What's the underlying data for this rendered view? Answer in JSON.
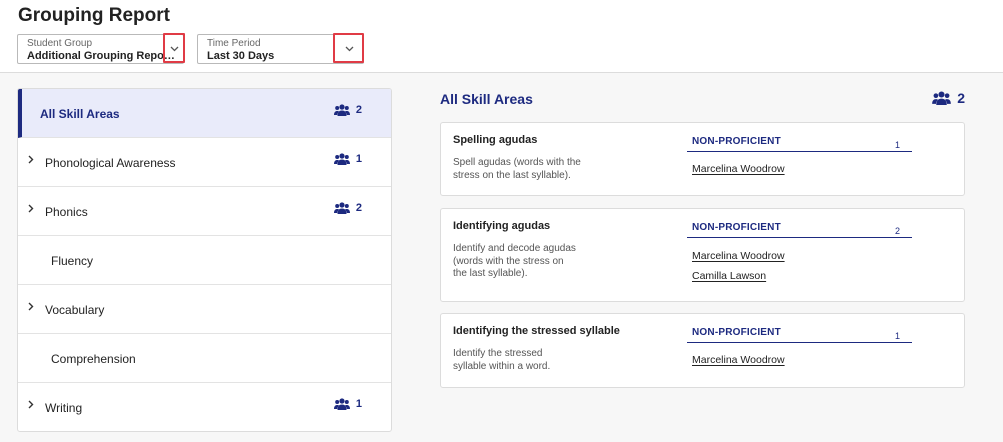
{
  "header": {
    "title": "Grouping Report",
    "filters": [
      {
        "label": "Student Group",
        "value": "Additional Grouping Report ..."
      },
      {
        "label": "Time Period",
        "value": "Last 30 Days"
      }
    ]
  },
  "sidebar": {
    "items": [
      {
        "label": "All Skill Areas",
        "count": "2"
      },
      {
        "label": "Phonological Awareness",
        "count": "1"
      },
      {
        "label": "Phonics",
        "count": "2"
      },
      {
        "label": "Fluency",
        "count": ""
      },
      {
        "label": "Vocabulary",
        "count": ""
      },
      {
        "label": "Comprehension",
        "count": ""
      },
      {
        "label": "Writing",
        "count": "1"
      }
    ]
  },
  "main": {
    "title": "All Skill Areas",
    "count": "2",
    "cards": [
      {
        "title": "Spelling agudas",
        "desc_lines": [
          "Spell agudas (words with the",
          "stress on the last syllable)."
        ],
        "proficiency": "NON-PROFICIENT",
        "count": "1",
        "students": [
          "Marcelina Woodrow"
        ]
      },
      {
        "title": "Identifying agudas",
        "desc_lines": [
          "Identify and decode agudas",
          "(words with the stress on",
          "the last syllable)."
        ],
        "proficiency": "NON-PROFICIENT",
        "count": "2",
        "students": [
          "Marcelina Woodrow",
          "Camilla Lawson"
        ]
      },
      {
        "title": "Identifying the stressed syllable",
        "desc_lines": [
          "Identify the stressed",
          "syllable within a word."
        ],
        "proficiency": "NON-PROFICIENT",
        "count": "1",
        "students": [
          "Marcelina Woodrow"
        ]
      }
    ]
  },
  "icons": {
    "group": "group-people-icon",
    "chevron_right": "chevron-right-icon",
    "chevron_down": "chevron-down-icon"
  },
  "colors": {
    "accent": "#1d2a80",
    "active_bg": "#e9ebfa",
    "highlight_box": "#e03b45"
  }
}
